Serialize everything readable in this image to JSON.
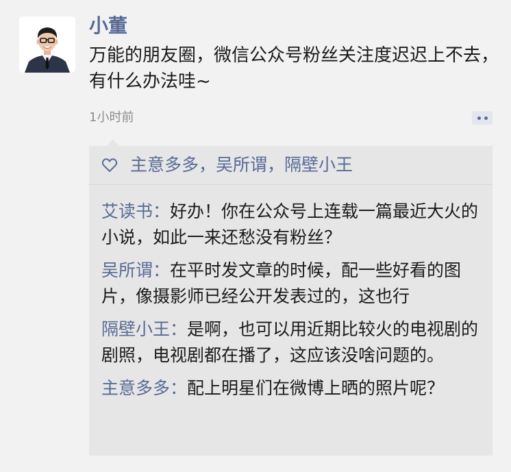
{
  "post": {
    "author": "小董",
    "text": "万能的朋友圈，微信公众号粉丝关注度迟迟上不去，有什么办法哇~",
    "time": "1小时前"
  },
  "likes": {
    "names": "主意多多，吴所谓，隔壁小王"
  },
  "comments": [
    {
      "author": "艾读书",
      "separator": "：",
      "text": "好办！你在公众号上连载一篇最近大火的小说，如此一来还愁没有粉丝？"
    },
    {
      "author": "吴所谓",
      "separator": "：",
      "text": "在平时发文章的时候，配一些好看的图片，像摄影师已经公开发表过的，这也行"
    },
    {
      "author": "隔壁小王",
      "separator": "：",
      "text": "是啊，也可以用近期比较火的电视剧的剧照，电视剧都在播了，这应该没啥问题的。"
    },
    {
      "author": "主意多多",
      "separator": "：",
      "text": "配上明星们在微博上晒的照片呢？"
    }
  ],
  "colors": {
    "link": "#576b95",
    "box_background": "#e6e6e6",
    "page_background": "#f2f2f2"
  },
  "icons": {
    "avatar": "avatar-icon",
    "like": "heart-icon",
    "more": "more-icon"
  }
}
